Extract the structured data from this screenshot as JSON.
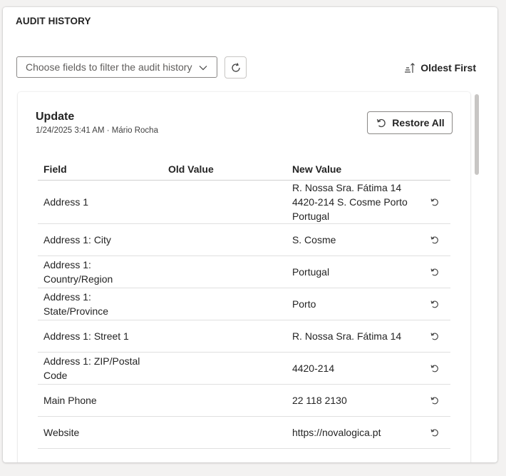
{
  "panel": {
    "title": "AUDIT HISTORY"
  },
  "toolbar": {
    "filter_placeholder": "Choose fields to filter the audit history",
    "refresh_icon": "refresh-icon",
    "sort_label": "Oldest First",
    "sort_icon": "sort-ascending-icon"
  },
  "entry": {
    "title": "Update",
    "meta": "1/24/2025 3:41 AM · Mário Rocha",
    "restore_all_label": "Restore All",
    "restore_icon": "undo-icon"
  },
  "table": {
    "headers": {
      "field": "Field",
      "old_value": "Old Value",
      "new_value": "New Value"
    },
    "rows": [
      {
        "field": "Address 1",
        "old_value": "",
        "new_value": "R. Nossa Sra. Fátima 14\n4420-214 S. Cosme Porto\nPortugal"
      },
      {
        "field": "Address 1: City",
        "old_value": "",
        "new_value": "S. Cosme"
      },
      {
        "field": "Address 1: Country/Region",
        "old_value": "",
        "new_value": "Portugal"
      },
      {
        "field": "Address 1: State/Province",
        "old_value": "",
        "new_value": "Porto"
      },
      {
        "field": "Address 1: Street 1",
        "old_value": "",
        "new_value": "R. Nossa Sra. Fátima 14"
      },
      {
        "field": "Address 1: ZIP/Postal Code",
        "old_value": "",
        "new_value": "4420-214"
      },
      {
        "field": "Main Phone",
        "old_value": "",
        "new_value": "22 118 2130"
      },
      {
        "field": "Website",
        "old_value": "",
        "new_value": "https://novalogica.pt"
      }
    ]
  }
}
